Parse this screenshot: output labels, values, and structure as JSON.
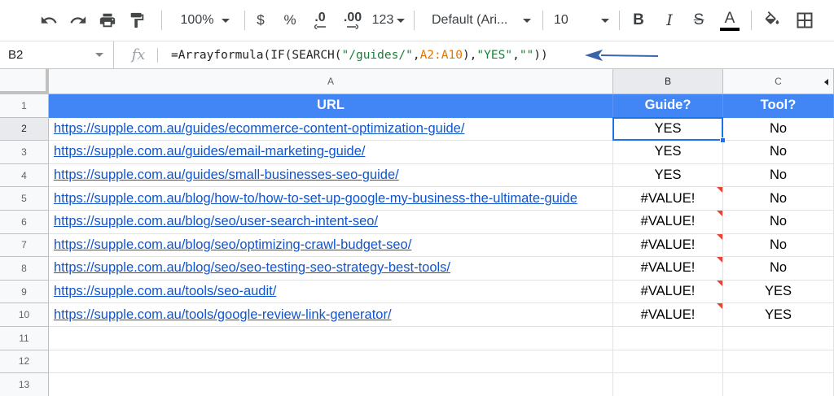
{
  "toolbar": {
    "zoom": "100%",
    "currency": "$",
    "percent": "%",
    "decrease_decimal": ".0",
    "increase_decimal": ".00",
    "more_formats": "123",
    "font_family": "Default (Ari...",
    "font_size": "10",
    "bold": "B",
    "italic": "I",
    "strikethrough": "S",
    "text_color": "A",
    "icons": [
      "undo-icon",
      "redo-icon",
      "print-icon",
      "paint-format-icon",
      "fill-color-icon",
      "borders-icon"
    ]
  },
  "formula_bar": {
    "cell_ref": "B2",
    "fx": "fx",
    "formula_parts": [
      {
        "text": "=Arrayformula(IF(SEARCH(",
        "color": "#202124"
      },
      {
        "text": "\"/guides/\"",
        "color": "#188038"
      },
      {
        "text": ",",
        "color": "#202124"
      },
      {
        "text": "A2:A10",
        "color": "#e37400"
      },
      {
        "text": "),",
        "color": "#202124"
      },
      {
        "text": "\"YES\"",
        "color": "#188038"
      },
      {
        "text": ",",
        "color": "#202124"
      },
      {
        "text": "\"\"",
        "color": "#188038"
      },
      {
        "text": "))",
        "color": "#202124"
      }
    ]
  },
  "sheet": {
    "columns": [
      "A",
      "B",
      "C"
    ],
    "selected_column": "B",
    "selected_row": "2",
    "rows": [
      {
        "num": "1",
        "a": "URL",
        "b": "Guide?",
        "c": "Tool?",
        "header": true
      },
      {
        "num": "2",
        "a": "https://supple.com.au/guides/ecommerce-content-optimization-guide/",
        "b": "YES",
        "c": "No"
      },
      {
        "num": "3",
        "a": "https://supple.com.au/guides/email-marketing-guide/",
        "b": "YES",
        "c": "No"
      },
      {
        "num": "4",
        "a": "https://supple.com.au/guides/small-businesses-seo-guide/",
        "b": "YES",
        "c": "No"
      },
      {
        "num": "5",
        "a": "https://supple.com.au/blog/how-to/how-to-set-up-google-my-business-the-ultimate-guide",
        "b": "#VALUE!",
        "c": "No",
        "error": true
      },
      {
        "num": "6",
        "a": "https://supple.com.au/blog/seo/user-search-intent-seo/",
        "b": "#VALUE!",
        "c": "No",
        "error": true
      },
      {
        "num": "7",
        "a": "https://supple.com.au/blog/seo/optimizing-crawl-budget-seo/",
        "b": "#VALUE!",
        "c": "No",
        "error": true
      },
      {
        "num": "8",
        "a": "https://supple.com.au/blog/seo/seo-testing-seo-strategy-best-tools/",
        "b": "#VALUE!",
        "c": "No",
        "error": true
      },
      {
        "num": "9",
        "a": "https://supple.com.au/tools/seo-audit/",
        "b": "#VALUE!",
        "c": "YES",
        "error": true
      },
      {
        "num": "10",
        "a": "https://supple.com.au/tools/google-review-link-generator/",
        "b": "#VALUE!",
        "c": "YES",
        "error": true
      },
      {
        "num": "11",
        "a": "",
        "b": "",
        "c": ""
      },
      {
        "num": "12",
        "a": "",
        "b": "",
        "c": ""
      },
      {
        "num": "13",
        "a": "",
        "b": "",
        "c": ""
      }
    ]
  },
  "colors": {
    "header_fill": "#4285f4",
    "link": "#1155cc",
    "selection": "#1a73e8",
    "error_marker": "#ea4335",
    "annotation_arrow": "#3b63a8"
  }
}
